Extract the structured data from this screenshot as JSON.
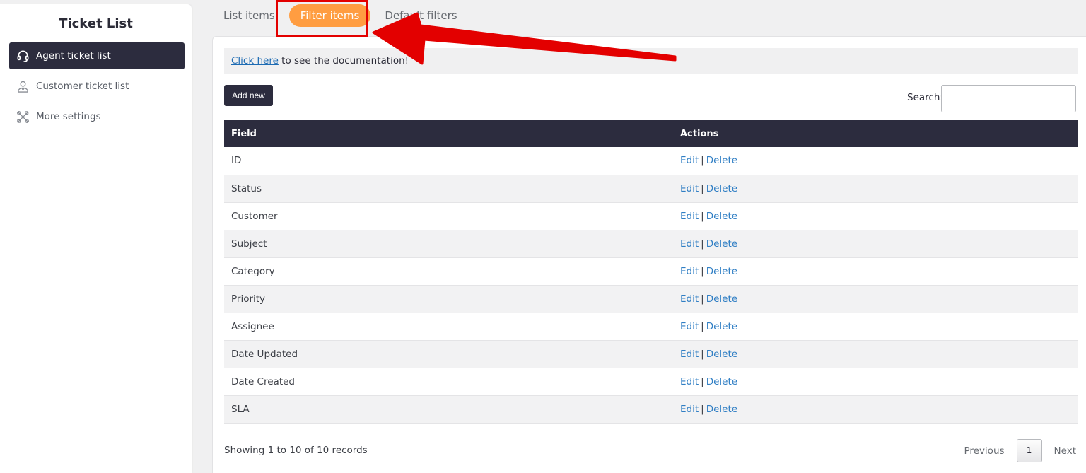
{
  "sidebar": {
    "title": "Ticket List",
    "items": [
      {
        "label": "Agent ticket list",
        "icon": "headset-icon",
        "active": true
      },
      {
        "label": "Customer ticket list",
        "icon": "customer-icon",
        "active": false
      },
      {
        "label": "More settings",
        "icon": "tools-icon",
        "active": false
      }
    ]
  },
  "tabs": {
    "list_items": "List items",
    "filter_items": "Filter items",
    "default_filters": "Default filters",
    "active": "Filter items"
  },
  "doc": {
    "link_text": "Click here",
    "rest_text": " to see the documentation!"
  },
  "toolbar": {
    "add_new_label": "Add new",
    "search_label": "Search:",
    "search_value": ""
  },
  "table": {
    "headers": {
      "field": "Field",
      "actions": "Actions"
    },
    "rows": [
      {
        "field": "ID"
      },
      {
        "field": "Status"
      },
      {
        "field": "Customer"
      },
      {
        "field": "Subject"
      },
      {
        "field": "Category"
      },
      {
        "field": "Priority"
      },
      {
        "field": "Assignee"
      },
      {
        "field": "Date Updated"
      },
      {
        "field": "Date Created"
      },
      {
        "field": "SLA"
      }
    ],
    "edit_label": "Edit",
    "separator": "|",
    "delete_label": "Delete"
  },
  "footer": {
    "showing": "Showing 1 to 10 of 10 records",
    "previous": "Previous",
    "page": "1",
    "next": "Next"
  },
  "colors": {
    "accent": "#ff9d41",
    "dark": "#2c2c3e",
    "link": "#2f7ec4",
    "annotation": "#e30000"
  }
}
